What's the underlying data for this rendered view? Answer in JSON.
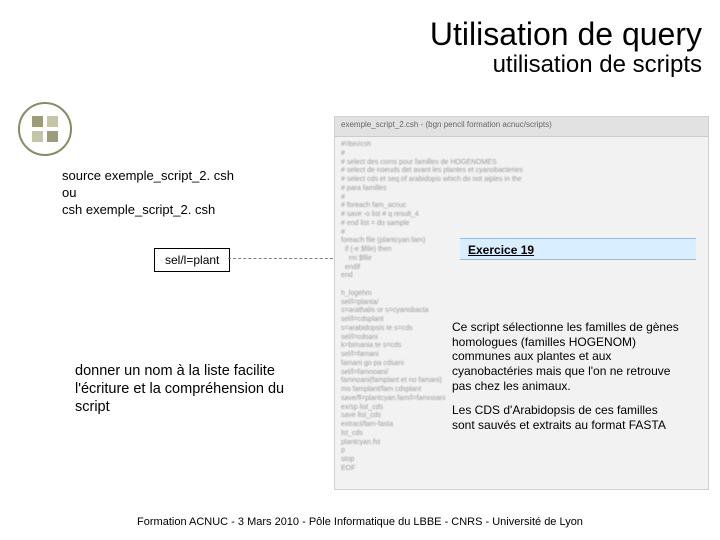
{
  "title": {
    "main": "Utilisation de query",
    "sub": "utilisation de scripts"
  },
  "commands": {
    "line1": "source exemple_script_2. csh",
    "line2": "ou",
    "line3": "csh exemple_script_2. csh"
  },
  "sel_label": "sel/l=plant",
  "note": "donner un nom à la liste facilite l'écriture et la compréhension du script",
  "screenshot": {
    "titlebar": "exemple_script_2.csh - (bgn pencil formation acnuc/scripts)"
  },
  "exercice_label": "Exercice 19",
  "description": {
    "p1": "Ce script sélectionne les familles de gènes homologues (familles HOGENOM)  communes aux plantes et aux cyanobactéries mais que l'on ne retrouve pas chez les animaux.",
    "p2": "Les CDS d'Arabidopsis de ces familles sont sauvés et extraits au format FASTA"
  },
  "footer": "Formation ACNUC -  3 Mars 2010 - Pôle Informatique du LBBE - CNRS - Université de Lyon"
}
